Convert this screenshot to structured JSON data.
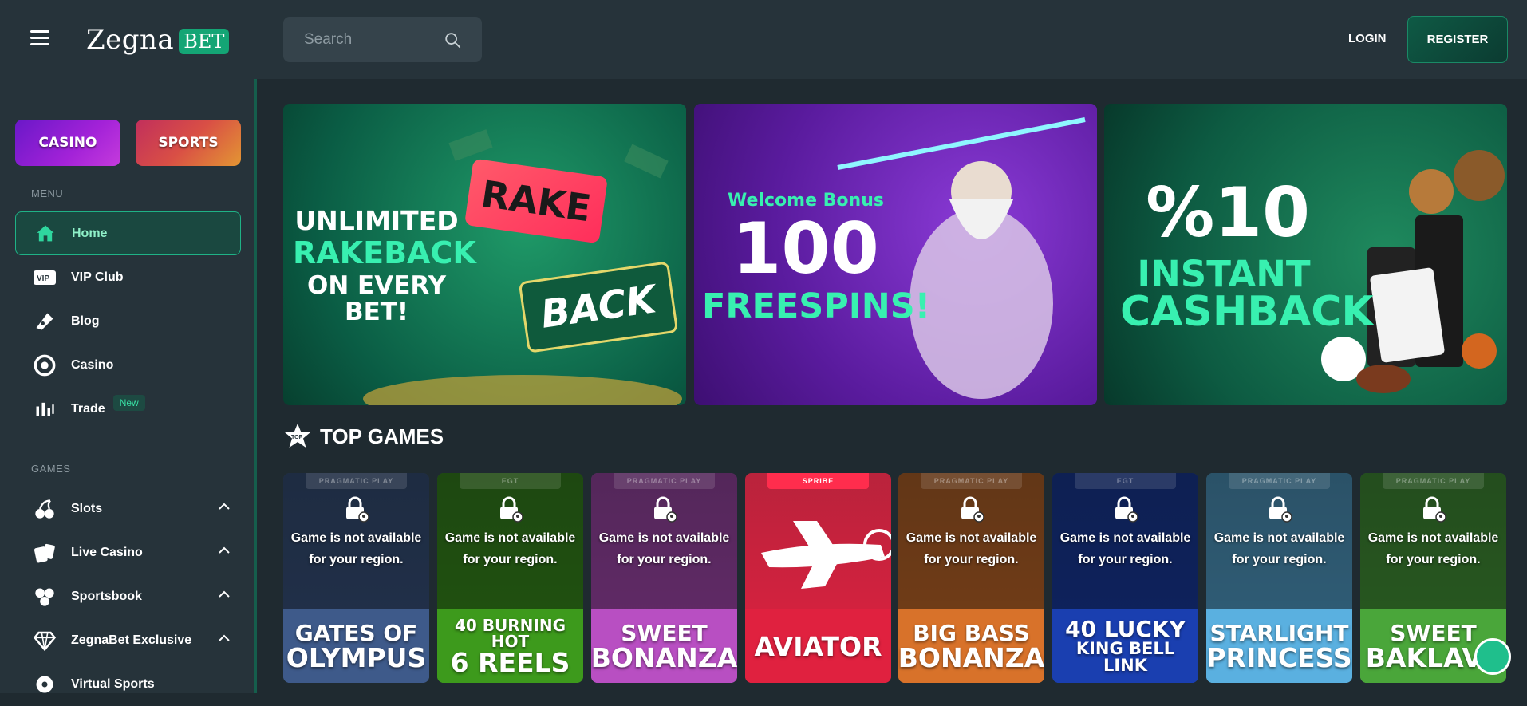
{
  "header": {
    "logo_text": "Zegna",
    "logo_badge": "BET",
    "search_placeholder": "Search",
    "login_label": "LOGIN",
    "register_label": "REGISTER"
  },
  "sidebar": {
    "mode_tiles": [
      {
        "label": "CASINO"
      },
      {
        "label": "SPORTS"
      }
    ],
    "menu_label": "MENU",
    "menu_items": [
      {
        "label": "Home",
        "icon": "home-icon",
        "active": true
      },
      {
        "label": "VIP Club",
        "icon": "vip-icon"
      },
      {
        "label": "Blog",
        "icon": "blog-icon"
      },
      {
        "label": "Casino",
        "icon": "casino-chip-icon"
      },
      {
        "label": "Trade",
        "icon": "trade-chart-icon",
        "badge": "New"
      }
    ],
    "games_label": "GAMES",
    "game_items": [
      {
        "label": "Slots",
        "icon": "cherries-icon"
      },
      {
        "label": "Live Casino",
        "icon": "cards-icon"
      },
      {
        "label": "Sportsbook",
        "icon": "balls-icon"
      },
      {
        "label": "ZegnaBet Exclusive",
        "icon": "diamond-icon"
      },
      {
        "label": "Virtual Sports",
        "icon": "virtual-icon"
      }
    ]
  },
  "banners": [
    {
      "line1": "UNLIMITED",
      "line2": "RAKEBACK",
      "line3": "ON EVERY BET!",
      "tag1": "RAKE",
      "tag2": "BACK"
    },
    {
      "line1": "Welcome Bonus",
      "line2": "100",
      "line3": "FREESPINS!"
    },
    {
      "line1": "%10",
      "line2": "INSTANT",
      "line3": "CASHBACK"
    }
  ],
  "top_games": {
    "title": "TOP GAMES",
    "unavailable_line1": "Game is not available",
    "unavailable_line2": "for your region.",
    "games": [
      {
        "provider": "PRAGMATIC PLAY",
        "title_l1": "GATES OF",
        "title_l2": "OLYMPUS",
        "color": "#3e5a8a",
        "locked": true
      },
      {
        "provider": "EGT",
        "title_l1": "40 BURNING HOT",
        "title_l2": "6 REELS",
        "color": "#3d9a1c",
        "locked": true
      },
      {
        "provider": "PRAGMATIC PLAY",
        "title_l1": "SWEET",
        "title_l2": "BONANZA",
        "color": "#b84fc2",
        "locked": true
      },
      {
        "provider": "SPRIBE",
        "title_l1": "",
        "title_l2": "AVIATOR",
        "color": "#e0213f",
        "locked": false
      },
      {
        "provider": "PRAGMATIC PLAY",
        "title_l1": "BIG BASS",
        "title_l2": "BONANZA",
        "color": "#d8722a",
        "locked": true
      },
      {
        "provider": "EGT",
        "title_l1": "40 LUCKY",
        "title_l2": "KING BELL LINK",
        "color": "#1a3fb0",
        "locked": true
      },
      {
        "provider": "PRAGMATIC PLAY",
        "title_l1": "STARLIGHT",
        "title_l2": "PRINCESS",
        "color": "#5ab0e0",
        "locked": true
      },
      {
        "provider": "PRAGMATIC PLAY",
        "title_l1": "SWEET",
        "title_l2": "BAKLAVA",
        "color": "#4aa63a",
        "locked": true
      }
    ]
  }
}
